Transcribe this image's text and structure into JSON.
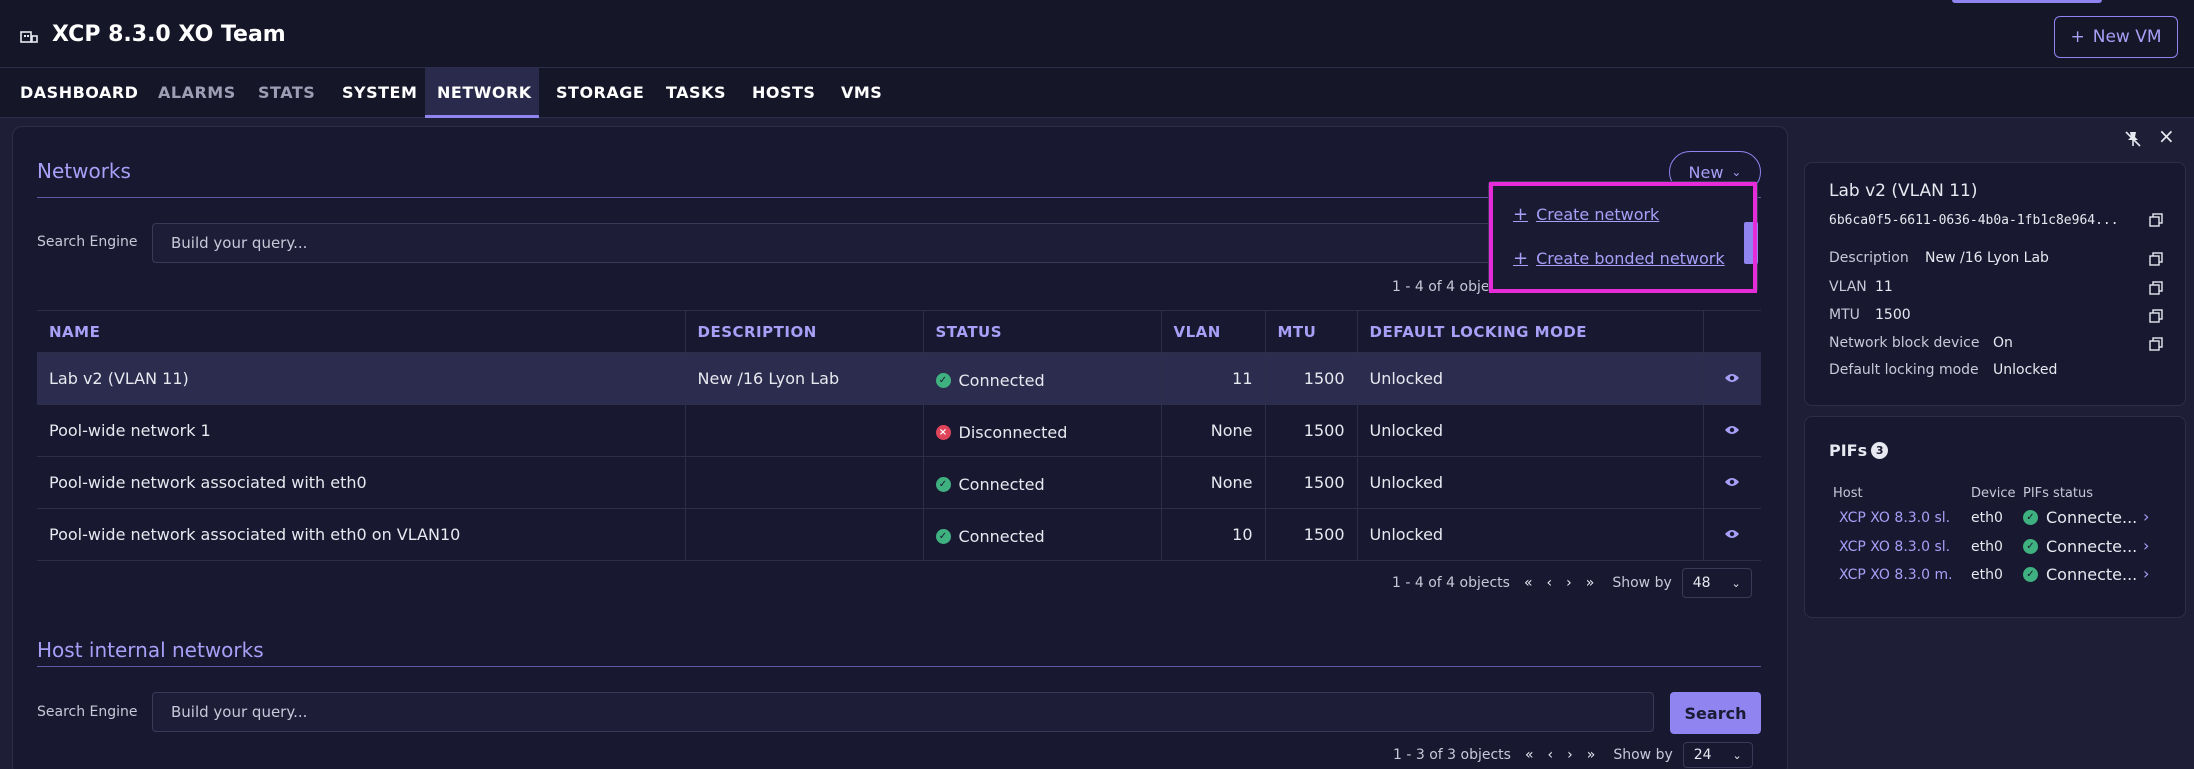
{
  "header": {
    "title": "XCP 8.3.0 XO Team",
    "new_vm_label": "New VM"
  },
  "tabs": [
    {
      "label": "DASHBOARD"
    },
    {
      "label": "ALARMS"
    },
    {
      "label": "STATS"
    },
    {
      "label": "SYSTEM"
    },
    {
      "label": "NETWORK"
    },
    {
      "label": "STORAGE"
    },
    {
      "label": "TASKS"
    },
    {
      "label": "HOSTS"
    },
    {
      "label": "VMS"
    }
  ],
  "networks": {
    "title": "Networks",
    "new_label": "New",
    "search_label": "Search Engine",
    "search_placeholder": "Build your query...",
    "pager_count": "1 - 4 of 4 objects",
    "pager_count_top": "1 - 4 of 4 objects",
    "show_by_label": "Show by",
    "show_by_value": "48",
    "columns": [
      "NAME",
      "DESCRIPTION",
      "STATUS",
      "VLAN",
      "MTU",
      "DEFAULT LOCKING MODE"
    ],
    "rows": [
      {
        "name": "Lab v2 (VLAN 11)",
        "description": "New /16 Lyon Lab",
        "status": "Connected",
        "vlan": "11",
        "mtu": "1500",
        "locking": "Unlocked"
      },
      {
        "name": "Pool-wide network 1",
        "description": "",
        "status": "Disconnected",
        "vlan": "None",
        "mtu": "1500",
        "locking": "Unlocked"
      },
      {
        "name": "Pool-wide network associated with eth0",
        "description": "",
        "status": "Connected",
        "vlan": "None",
        "mtu": "1500",
        "locking": "Unlocked"
      },
      {
        "name": "Pool-wide network associated with eth0 on VLAN10",
        "description": "",
        "status": "Connected",
        "vlan": "10",
        "mtu": "1500",
        "locking": "Unlocked"
      }
    ]
  },
  "new_menu": {
    "create_network": "Create network",
    "create_bonded_network": "Create bonded network"
  },
  "host_internal": {
    "title": "Host internal networks",
    "search_label": "Search Engine",
    "search_placeholder": "Build your query...",
    "search_button": "Search",
    "pager_count": "1 - 3 of 3 objects",
    "show_by_label": "Show by",
    "show_by_value": "24"
  },
  "side_panel": {
    "title": "Lab v2 (VLAN 11)",
    "uuid": "6b6ca0f5-6611-0636-4b0a-1fb1c8e964...",
    "properties": [
      {
        "label": "Description",
        "value": "New /16 Lyon Lab"
      },
      {
        "label": "VLAN",
        "value": "11"
      },
      {
        "label": "MTU",
        "value": "1500"
      },
      {
        "label": "Network block device",
        "value": "On"
      },
      {
        "label": "Default locking mode",
        "value": "Unlocked"
      }
    ],
    "pifs_title": "PIFs",
    "pifs_count": "3",
    "pif_headers": {
      "host": "Host",
      "device": "Device",
      "status": "PIFs status"
    },
    "pifs": [
      {
        "host": "XCP XO 8.3.0 sl...",
        "device": "eth0",
        "status": "Connecte..."
      },
      {
        "host": "XCP XO 8.3.0 sl...",
        "device": "eth0",
        "status": "Connecte..."
      },
      {
        "host": "XCP XO 8.3.0 m...",
        "device": "eth0",
        "status": "Connecte..."
      }
    ]
  }
}
